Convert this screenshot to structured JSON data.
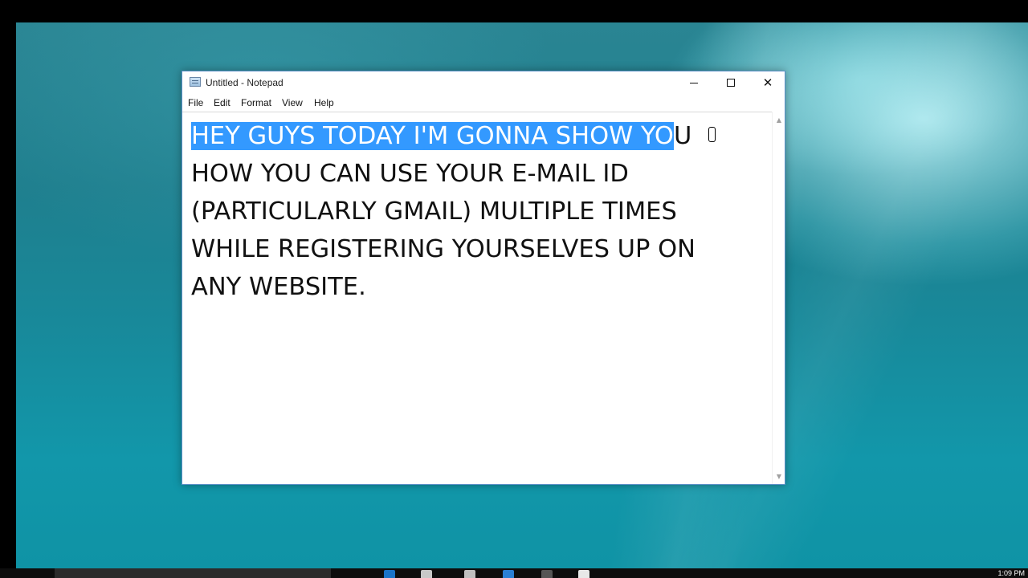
{
  "window": {
    "title": "Untitled - Notepad",
    "icon": "notepad-icon"
  },
  "controls": {
    "minimize_icon": "minimize-icon",
    "maximize_icon": "maximize-icon",
    "close_glyph": "✕"
  },
  "menu": {
    "items": [
      "File",
      "Edit",
      "Format",
      "View",
      "Help"
    ]
  },
  "editor": {
    "selected_text": "HEY GUYS TODAY I'M GONNA SHOW YO",
    "line1_rest": "U",
    "lines": [
      "HOW YOU CAN USE YOUR E-MAIL ID",
      "(PARTICULARLY GMAIL) MULTIPLE TIMES",
      "WHILE REGISTERING YOURSELVES UP ON",
      "ANY WEBSITE."
    ]
  },
  "scrollbar": {
    "up_glyph": "▲",
    "down_glyph": "▼"
  },
  "taskbar": {
    "clock": "1:09 PM"
  },
  "colors": {
    "selection": "#3399ff",
    "window_border": "#5a8fc7"
  }
}
